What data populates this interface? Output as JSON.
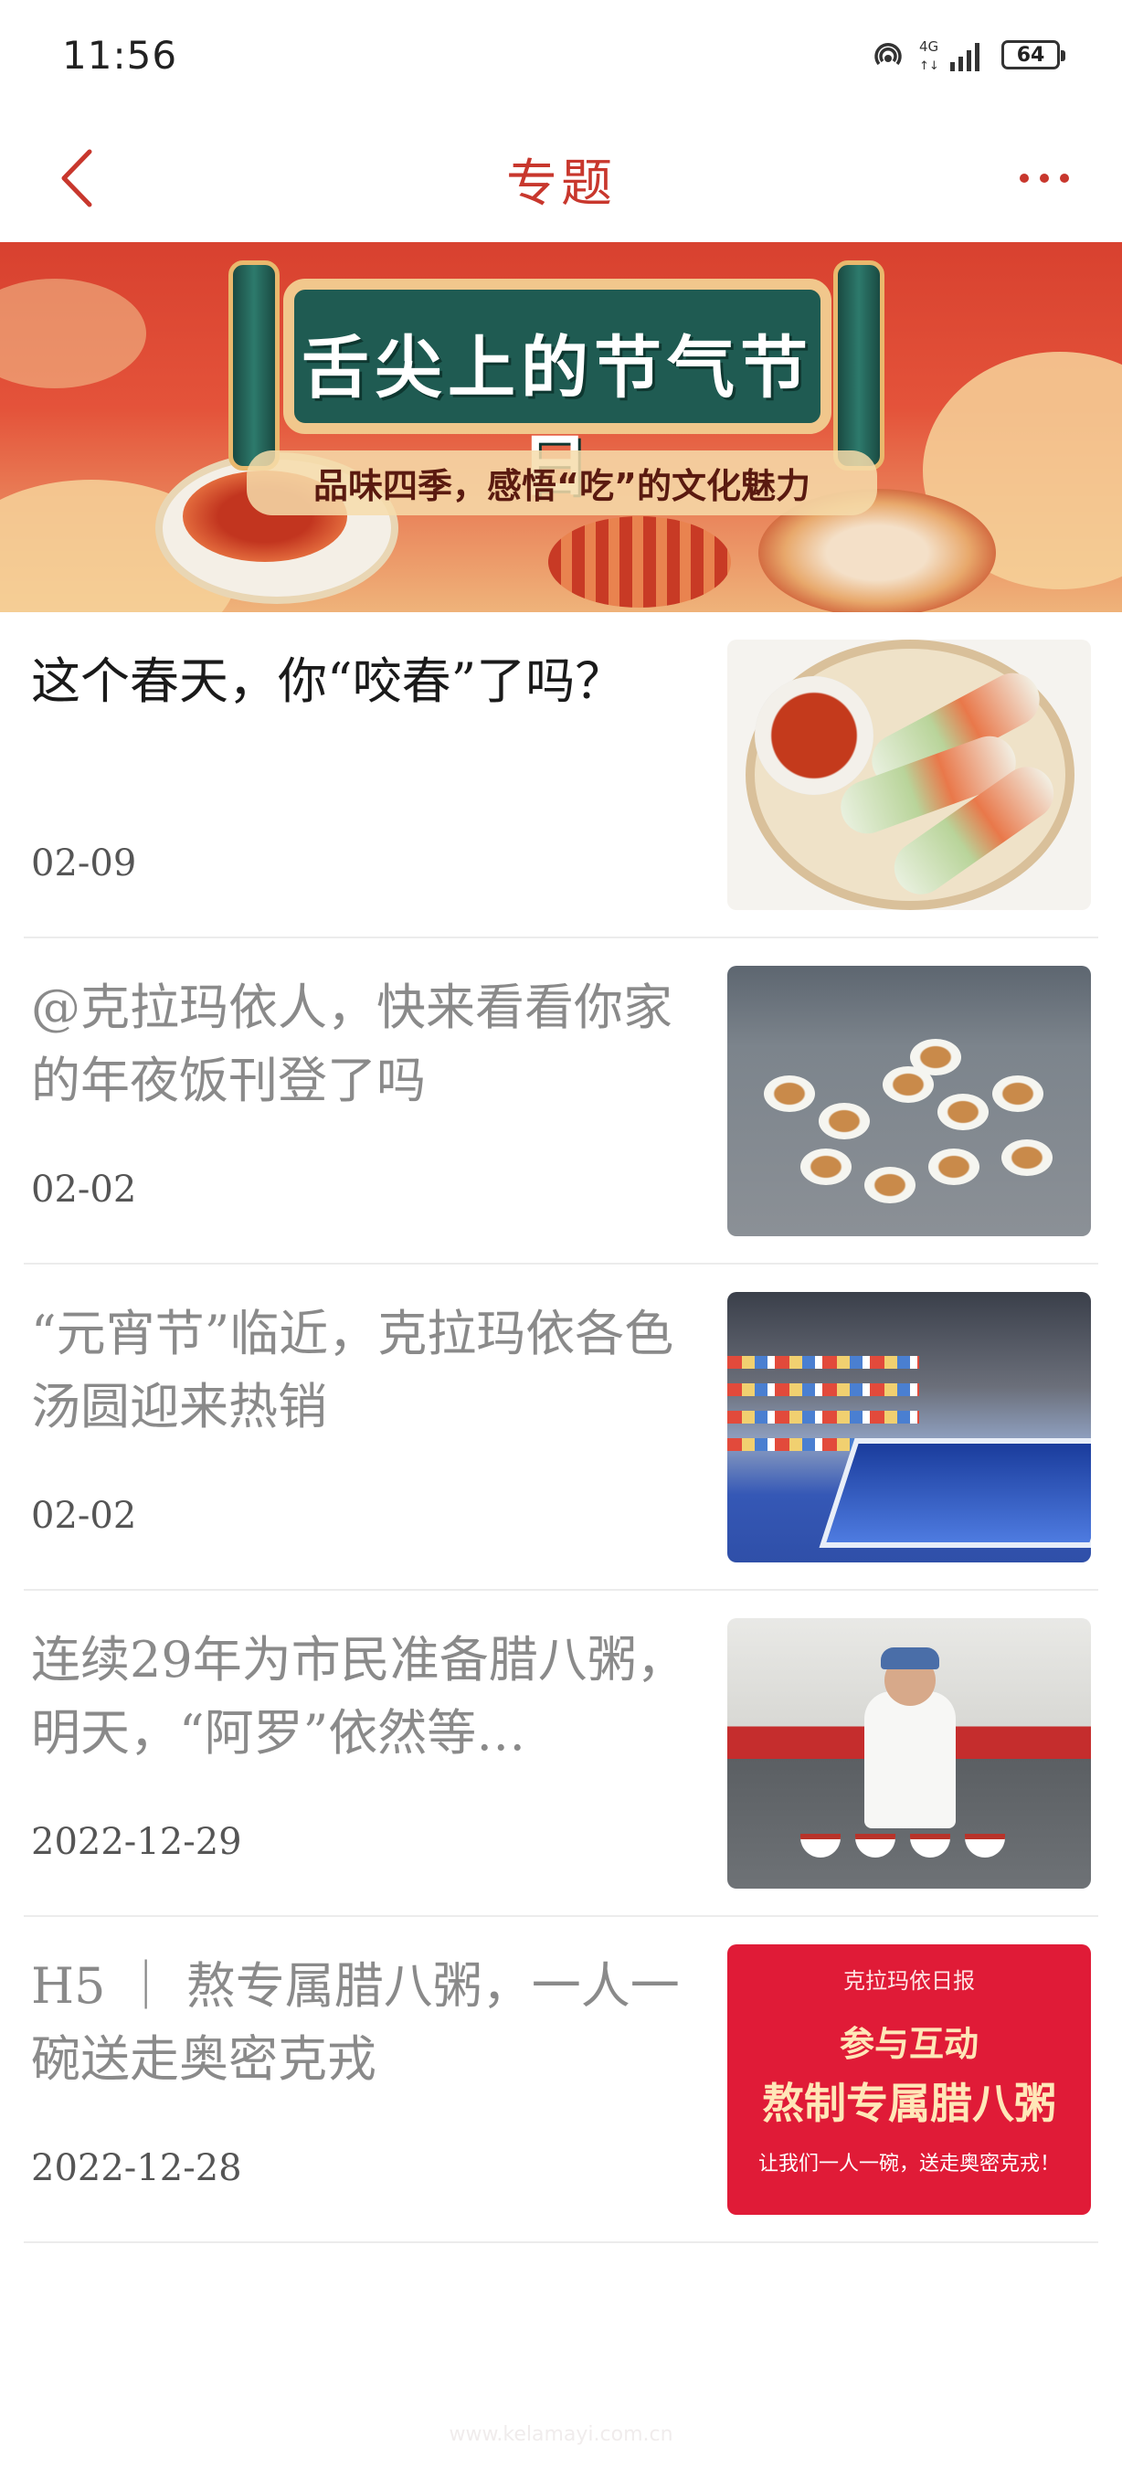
{
  "status_bar": {
    "time": "11:56",
    "network": "4G",
    "battery": "64",
    "icons": [
      "hotspot-icon",
      "signal-icon",
      "battery-icon"
    ]
  },
  "header": {
    "title": "专题",
    "back_icon": "chevron-left-icon",
    "more_icon": "more-dots-icon",
    "accent_color": "#c8372d"
  },
  "banner": {
    "title": "舌尖上的节气节日",
    "subtitle": "品味四季，感悟“吃”的文化魅力"
  },
  "articles": [
    {
      "title": "这个春天，你“咬春”了吗？",
      "date": "02-09",
      "read": false
    },
    {
      "title": "@克拉玛依人，快来看看你家的年夜饭刊登了吗",
      "date": "02-02",
      "read": true
    },
    {
      "title": "“元宵节”临近，克拉玛依各色汤圆迎来热销",
      "date": "02-02",
      "read": true
    },
    {
      "title": "连续29年为市民准备腊八粥，明天，“阿罗”依然等…",
      "date": "2022-12-29",
      "read": true
    },
    {
      "title": "H5 ｜ 熬专属腊八粥，一人一碗送走奥密克戎",
      "date": "2022-12-28",
      "read": true,
      "thumb_text": {
        "masthead": "克拉玛依日报",
        "line1": "参与互动",
        "line2": "熬制专属腊八粥",
        "line3": "让我们一人一碗，送走奥密克戎！"
      }
    }
  ],
  "watermark": "www.kelamayi.com.cn"
}
